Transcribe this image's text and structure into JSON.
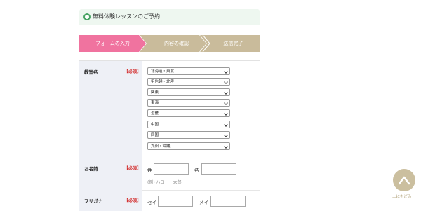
{
  "header": {
    "title": "無料体験レッスンのご予約"
  },
  "steps": [
    "フォームの入力",
    "内容の確認",
    "送信完了"
  ],
  "form": {
    "classroom": {
      "label": "教室名",
      "required": "【必須】",
      "selects": [
        "北海道・東北",
        "甲信越・北陸",
        "関東",
        "東海",
        "近畿",
        "中国",
        "四国",
        "九州・沖縄"
      ]
    },
    "name": {
      "label": "お名前",
      "required": "【必須】",
      "last_label": "姓",
      "first_label": "名",
      "example": "(例) ハロー　太郎"
    },
    "furigana": {
      "label": "フリガナ",
      "required": "【必須】",
      "last_label": "セイ",
      "first_label": "メイ"
    }
  },
  "back_to_top": {
    "label": "上にもどる",
    "icon": "chevron-up-icon"
  },
  "colors": {
    "accent_pink": "#f0739f",
    "step_beige": "#c9bb9b",
    "header_green": "#2f8f4e"
  }
}
